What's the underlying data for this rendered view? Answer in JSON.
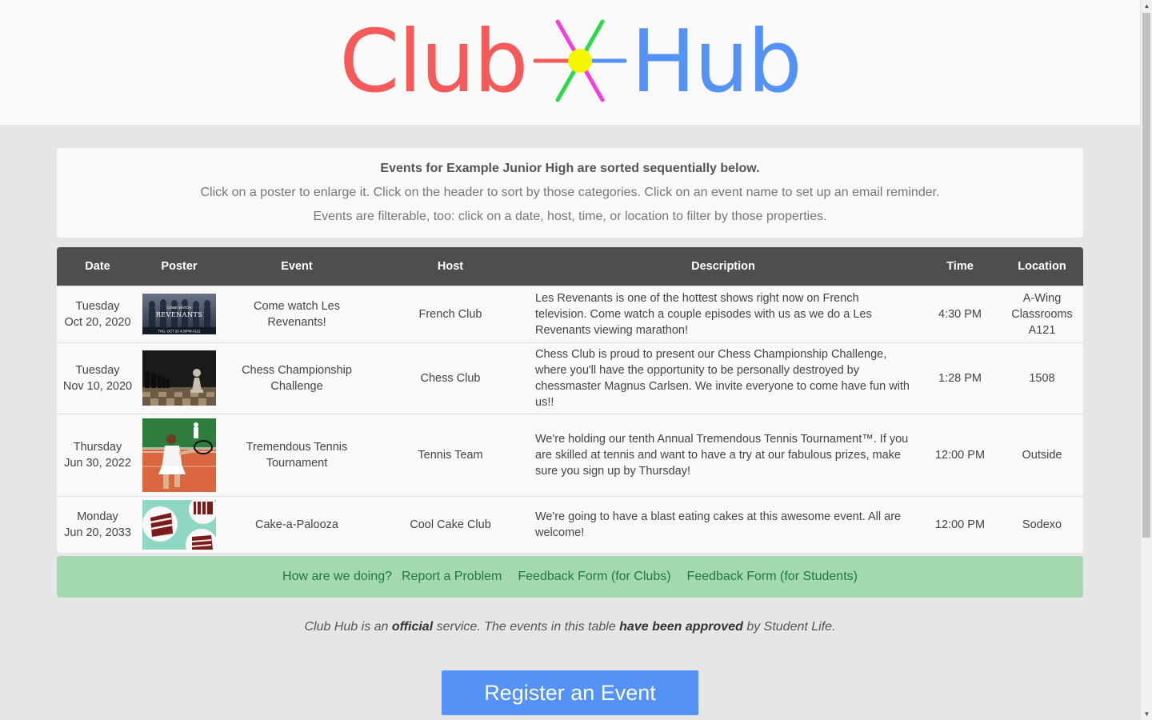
{
  "logo": {
    "left": "Club",
    "right": "Hub"
  },
  "info": {
    "title": "Events for Example Junior High are sorted sequentially below.",
    "line1": "Click on a poster to enlarge it. Click on the header to sort by those categories. Click on an event name to set up an email reminder.",
    "line2": "Events are filterable, too: click on a date, host, time, or location to filter by those properties."
  },
  "table": {
    "headers": {
      "date": "Date",
      "poster": "Poster",
      "event": "Event",
      "host": "Host",
      "description": "Description",
      "time": "Time",
      "location": "Location"
    },
    "rows": [
      {
        "day": "Tuesday",
        "date": "Oct 20, 2020",
        "event": "Come watch Les Revenants!",
        "host": "French Club",
        "description": "Les Revenants is one of the hottest shows right now on French television. Come watch a couple episodes with us as we do a Les Revenants viewing marathon!",
        "time": "4:30 PM",
        "location": "A-Wing Classrooms A121",
        "poster": {
          "top": "COME       WATCH",
          "mid": "REVENANTS",
          "bottom": "THU, OCT 20    4:30PM     A121"
        }
      },
      {
        "day": "Tuesday",
        "date": "Nov 10, 2020",
        "event": "Chess Championship Challenge",
        "host": "Chess Club",
        "description": "Chess Club is proud to present our Chess Championship Challenge, where you'll have the opportunity to be personally destroyed by chessmaster Magnus Carlsen. We invite everyone to come have fun with us!!",
        "time": "1:28 PM",
        "location": "1508"
      },
      {
        "day": "Thursday",
        "date": "Jun 30, 2022",
        "event": "Tremendous Tennis Tournament",
        "host": "Tennis Team",
        "description": "We're holding our tenth Annual Tremendous Tennis Tournament™. If you are skilled at tennis and want to have a try at our fabulous prizes, make sure you sign up by Thursday!",
        "time": "12:00 PM",
        "location": "Outside"
      },
      {
        "day": "Monday",
        "date": "Jun 20, 2033",
        "event": "Cake-a-Palooza",
        "host": "Cool Cake Club",
        "description": "We're going to have a blast eating cakes at this awesome event. All are welcome!",
        "time": "12:00 PM",
        "location": "Sodexo"
      }
    ]
  },
  "feedback": {
    "prompt": "How are we doing?",
    "report": "Report a Problem",
    "clubs": "Feedback Form (for Clubs)",
    "students": "Feedback Form (for Students)"
  },
  "note": {
    "p1": "Club Hub is an ",
    "b1": "official",
    "p2": " service. The events in this table ",
    "b2": "have been approved",
    "p3": " by Student Life."
  },
  "register_label": "Register an Event",
  "colors": {
    "club": "#f45a5a",
    "hub": "#5592f5",
    "header_bg": "#4e4e4e",
    "feedback_bg": "#a3d8b1",
    "button": "#5592f5"
  }
}
